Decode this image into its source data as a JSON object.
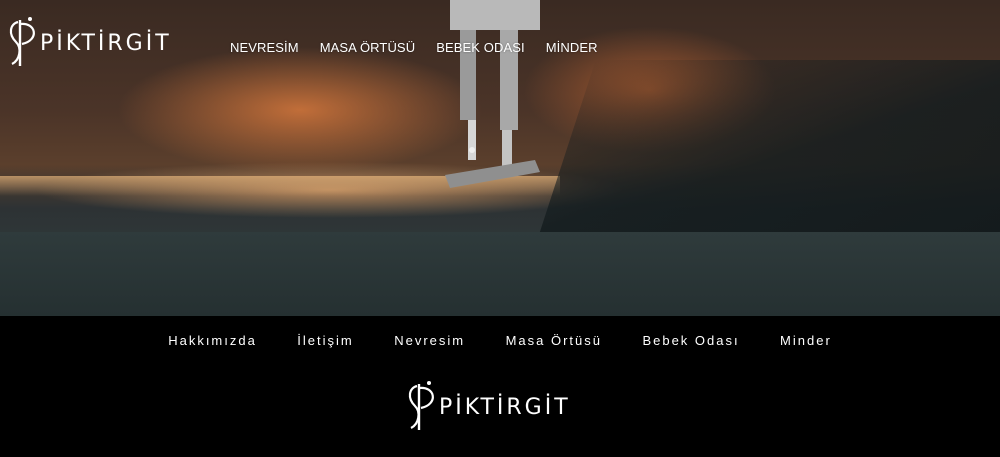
{
  "brand": {
    "name": "PİKTİRGİT",
    "logo_color": "#ffffff"
  },
  "header": {
    "nav": [
      {
        "label": "NEVRESİM"
      },
      {
        "label": "MASA ÖRTÜSÜ"
      },
      {
        "label": "BEBEK ODASI"
      },
      {
        "label": "MİNDER"
      }
    ]
  },
  "hero": {
    "image_subject": "sewing-machine"
  },
  "footer": {
    "nav": [
      {
        "label": "Hakkımızda"
      },
      {
        "label": "İletişim"
      },
      {
        "label": "Nevresim"
      },
      {
        "label": "Masa Örtüsü"
      },
      {
        "label": "Bebek Odası"
      },
      {
        "label": "Minder"
      }
    ],
    "background": "#000000"
  }
}
